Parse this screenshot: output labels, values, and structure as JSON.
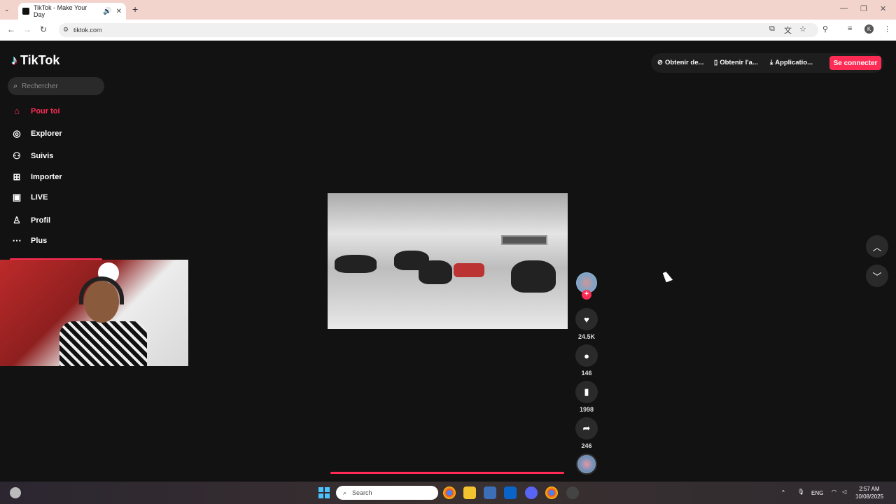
{
  "browser": {
    "tab_title": "TikTok - Make Your Day",
    "url": "tiktok.com"
  },
  "sidebar": {
    "logo_text": "TikTok",
    "search_placeholder": "Rechercher",
    "items": [
      {
        "label": "Pour toi",
        "icon": "home-icon",
        "active": true
      },
      {
        "label": "Explorer",
        "icon": "compass-icon"
      },
      {
        "label": "Suivis",
        "icon": "following-icon"
      },
      {
        "label": "Importer",
        "icon": "upload-icon"
      },
      {
        "label": "LIVE",
        "icon": "live-icon"
      },
      {
        "label": "Profil",
        "icon": "profile-icon"
      },
      {
        "label": "Plus",
        "icon": "more-icon"
      }
    ]
  },
  "header": {
    "coins_label": "Obtenir de...",
    "app_label": "Obtenir l'a...",
    "download_label": "Applicatio...",
    "login_label": "Se connecter"
  },
  "actions": {
    "likes": "24.5K",
    "comments": "146",
    "saves": "1998",
    "shares": "246"
  },
  "taskbar": {
    "search_placeholder": "Search",
    "lang": "ENG",
    "time": "2:57 AM",
    "date": "10/08/2025"
  },
  "colors": {
    "accent": "#fe2c55",
    "page_bg": "#121212"
  }
}
